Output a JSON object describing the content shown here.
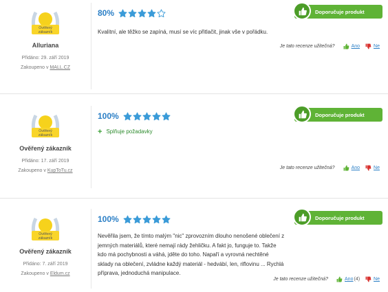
{
  "colors": {
    "accent": "#2b7fc6",
    "recommend_green": "#5fb336",
    "star": "#3a9bd8",
    "thumb_down": "#d8322f"
  },
  "badge_text": "Ověřený zákazník",
  "reviews": [
    {
      "author": "Alluriana",
      "added": "Přidáno: 29. září 2019",
      "bought_prefix": "Zakoupeno v",
      "shop": "MALL.CZ",
      "rating_pct": "80%",
      "stars": 4,
      "recommend_label": "Doporučuje produkt",
      "text": "Kvalitní, ale těžko se zapíná, musí se víc přitlačit, jinak vše v pořádku.",
      "pros": "",
      "useful_q": "Je tato recenze užitečná?",
      "yes_label": "Ano",
      "yes_count": "",
      "no_label": "Ne"
    },
    {
      "author": "Ověřený zákazník",
      "added": "Přidáno: 17. září 2019",
      "bought_prefix": "Zakoupeno v",
      "shop": "KupToTu.cz",
      "rating_pct": "100%",
      "stars": 5,
      "recommend_label": "Doporučuje produkt",
      "text": "",
      "pros": "Splňuje požadavky",
      "useful_q": "Je tato recenze užitečná?",
      "yes_label": "Ano",
      "yes_count": "",
      "no_label": "Ne"
    },
    {
      "author": "Ověřený zákazník",
      "added": "Přidáno: 7. září 2019",
      "bought_prefix": "Zakoupeno v",
      "shop": "Eldum.cz",
      "rating_pct": "100%",
      "stars": 5,
      "recommend_label": "Doporučuje produkt",
      "text": "Nevěřila jsem, že tímto malým \"nic\" zprovozním dlouho nenošené oblečení z jemných materiálů, které nemají rády žehličku. A fakt jo, funguje to. Takže kdo má pochybnosti a váhá, jděte do toho. Napaří a vyrovná nechtěné sklady na oblečení, zvládne každý materiál - hedvábí, len, riflovinu ... Rychlá příprava, jednoduchá manipulace.",
      "pros": "",
      "useful_q": "Je tato recenze užitečná?",
      "yes_label": "Ano",
      "yes_count": "(4)",
      "no_label": "Ne"
    }
  ]
}
